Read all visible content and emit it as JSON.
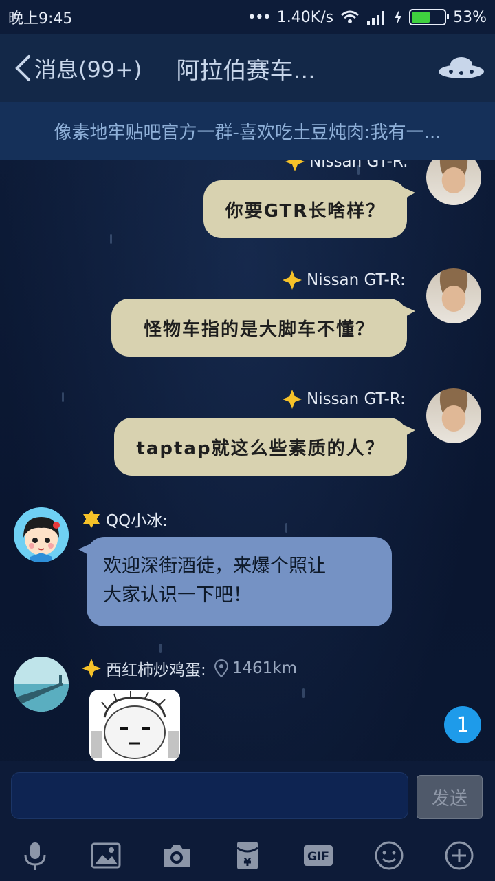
{
  "status_bar": {
    "time": "晚上9:45",
    "network_speed": "1.40K/s",
    "battery_percent": "53%",
    "battery_level": 0.53
  },
  "header": {
    "back_label": "消息(99+)",
    "title": "阿拉伯赛车..."
  },
  "announcement": "像素地牢贴吧官方一群-喜欢吃土豆炖肉:我有一...",
  "messages": [
    {
      "sender": "Nissan GT-R:",
      "text": "你要GTR长啥样？",
      "side": "right"
    },
    {
      "sender": "Nissan GT-R:",
      "text": "怪物车指的是大脚车不懂？",
      "side": "right"
    },
    {
      "sender": "Nissan GT-R:",
      "text": "taptap就这么些素质的人？",
      "side": "right"
    },
    {
      "sender": "QQ小冰:",
      "text_line1": "欢迎深街酒徒，来爆个照让",
      "text_line2": "大家认识一下吧！",
      "side": "left"
    },
    {
      "sender": "西红柿炒鸡蛋:",
      "distance": "1461km",
      "side": "left"
    }
  ],
  "partial_sender_top": "Nissan GT-R:",
  "unread_badge": "1",
  "input": {
    "placeholder": "",
    "send_label": "发送"
  },
  "toolbar_icons": [
    "microphone-icon",
    "image-icon",
    "camera-icon",
    "red-packet-icon",
    "gif-icon",
    "emoji-icon",
    "plus-icon"
  ],
  "colors": {
    "background": "#0c1a34",
    "right_bubble": "#d8d2b0",
    "left_bubble": "#7592c4",
    "badge": "#1e9bea",
    "battery_fill": "#3fd13f"
  }
}
